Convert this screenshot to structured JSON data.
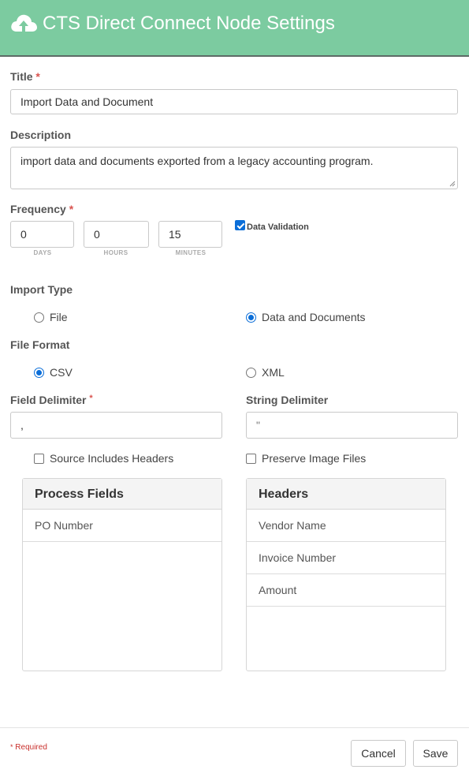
{
  "header": {
    "title": "CTS Direct Connect Node Settings",
    "icon": "cloud-upload-icon",
    "color": "#7ccba0"
  },
  "form": {
    "title_label": "Title",
    "required_mark": "*",
    "title_value": "Import Data and Document",
    "description_label": "Description",
    "description_value": "import data and documents exported from a legacy accounting program.",
    "frequency_label": "Frequency",
    "days_value": "0",
    "hours_value": "0",
    "minutes_value": "15",
    "days_caption": "DAYS",
    "hours_caption": "HOURS",
    "minutes_caption": "MINUTES",
    "data_validation_label": "Data Validation",
    "data_validation_checked": true,
    "import_type_label": "Import Type",
    "import_type_options": [
      "File",
      "Data and Documents"
    ],
    "import_type_selected": "Data and Documents",
    "file_format_label": "File Format",
    "file_format_options": [
      "CSV",
      "XML"
    ],
    "file_format_selected": "CSV",
    "field_delimiter_label": "Field Delimiter",
    "field_delimiter_value": ",",
    "string_delimiter_label": "String Delimiter",
    "string_delimiter_value": "\"",
    "source_headers_label": "Source Includes Headers",
    "preserve_images_label": "Preserve Image Files"
  },
  "process_fields": {
    "title": "Process Fields",
    "items": [
      "PO Number"
    ]
  },
  "headers_panel": {
    "title": "Headers",
    "items": [
      "Vendor Name",
      "Invoice Number",
      "Amount"
    ]
  },
  "footer": {
    "required_note": "Required",
    "cancel_label": "Cancel",
    "save_label": "Save"
  },
  "colors": {
    "accent": "#0b6ed8",
    "required": "#d9534f"
  }
}
